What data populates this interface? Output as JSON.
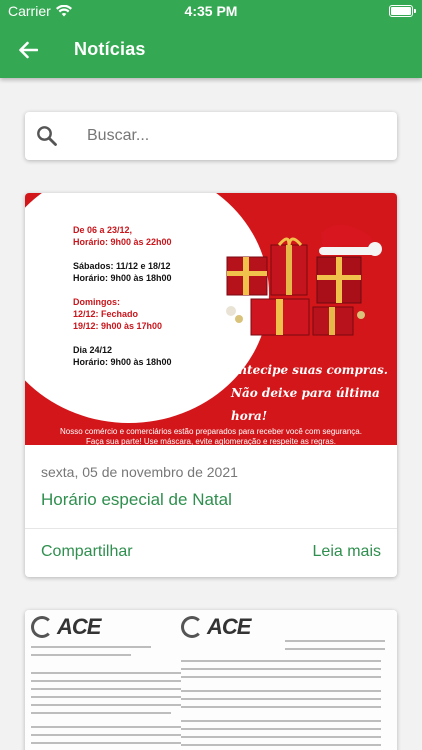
{
  "status_bar": {
    "carrier": "Carrier",
    "time": "4:35 PM"
  },
  "header": {
    "title": "Notícias"
  },
  "search": {
    "placeholder": "Buscar..."
  },
  "news": [
    {
      "image": {
        "hours_line1": "De 06 a 23/12,",
        "hours_line2": "Horário: 9h00 às 22h00",
        "saturdays_line1": "Sábados: 11/12 e 18/12",
        "saturdays_line2": "Horário: 9h00 às 18h00",
        "sundays_line1": "Domingos:",
        "sundays_line2": "12/12: Fechado",
        "sundays_line3": "19/12: 9h00 às 17h00",
        "day24_line1": "Dia 24/12",
        "day24_line2": "Horário: 9h00 às 18h00",
        "slogan_line1": "Antecipe suas compras.",
        "slogan_line2": "Não deixe para última hora!",
        "footer_line1": "Nosso comércio e comerciários estão preparados para receber você com segurança.",
        "footer_line2": "Faça sua parte! Use máscara, evite aglomeração e respeite as regras."
      },
      "date": "sexta, 05 de novembro de 2021",
      "title": "Horário especial de Natal",
      "share_label": "Compartilhar",
      "read_more_label": "Leia mais"
    },
    {
      "image": {
        "logo_text_left": "ACE",
        "logo_text_right": "ACE"
      }
    }
  ],
  "colors": {
    "primary": "#35a853",
    "accent_text": "#2f8f4e",
    "xmas_red": "#d3161a"
  }
}
